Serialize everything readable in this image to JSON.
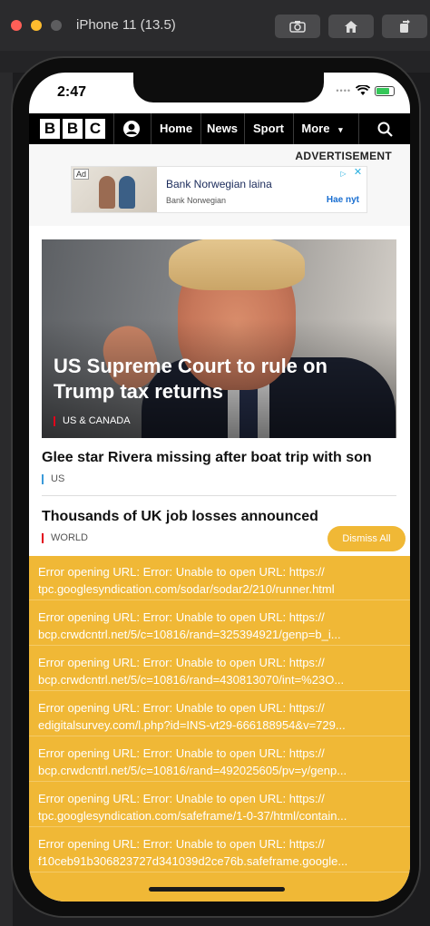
{
  "simulator": {
    "title": "iPhone 11 (13.5)",
    "buttons": [
      "screenshot-icon",
      "home-icon",
      "rotate-icon"
    ]
  },
  "status_bar": {
    "time": "2:47",
    "battery_color": "#35c759"
  },
  "bbc": {
    "logo": [
      "B",
      "B",
      "C"
    ],
    "nav": {
      "home": "Home",
      "news": "News",
      "sport": "Sport",
      "more": "More"
    }
  },
  "advertisement": {
    "label": "ADVERTISEMENT",
    "badge": "Ad",
    "title": "Bank Norwegian laina",
    "advertiser": "Bank Norwegian",
    "cta": "Hae nyt"
  },
  "hero": {
    "headline": "US Supreme Court to rule on Trump tax returns",
    "section": "US & CANADA",
    "section_color": "#e2001a"
  },
  "stories": [
    {
      "headline": "Glee star Rivera missing after boat trip with son",
      "section": "US",
      "section_color": "#3a9ad9"
    },
    {
      "headline": "Thousands of UK job losses announced",
      "section": "WORLD",
      "section_color": "#e2001a"
    }
  ],
  "errors": {
    "dismiss_label": "Dismiss All",
    "accent": "#f0b836",
    "items": [
      {
        "line1": "Error opening URL:  Error: Unable to open URL: https://",
        "line2": "tpc.googlesyndication.com/sodar/sodar2/210/runner.html"
      },
      {
        "line1": "Error opening URL:  Error: Unable to open URL: https://",
        "line2": "bcp.crwdcntrl.net/5/c=10816/rand=325394921/genp=b_i..."
      },
      {
        "line1": "Error opening URL:  Error: Unable to open URL: https://",
        "line2": "bcp.crwdcntrl.net/5/c=10816/rand=430813070/int=%23O..."
      },
      {
        "line1": "Error opening URL:  Error: Unable to open URL: https://",
        "line2": "edigitalsurvey.com/l.php?id=INS-vt29-666188954&v=729..."
      },
      {
        "line1": "Error opening URL:  Error: Unable to open URL: https://",
        "line2": "bcp.crwdcntrl.net/5/c=10816/rand=492025605/pv=y/genp..."
      },
      {
        "line1": "Error opening URL:  Error: Unable to open URL: https://",
        "line2": "tpc.googlesyndication.com/safeframe/1-0-37/html/contain..."
      },
      {
        "line1": "Error opening URL:  Error: Unable to open URL: https://",
        "line2": "f10ceb91b306823727d341039d2ce76b.safeframe.google..."
      }
    ]
  }
}
